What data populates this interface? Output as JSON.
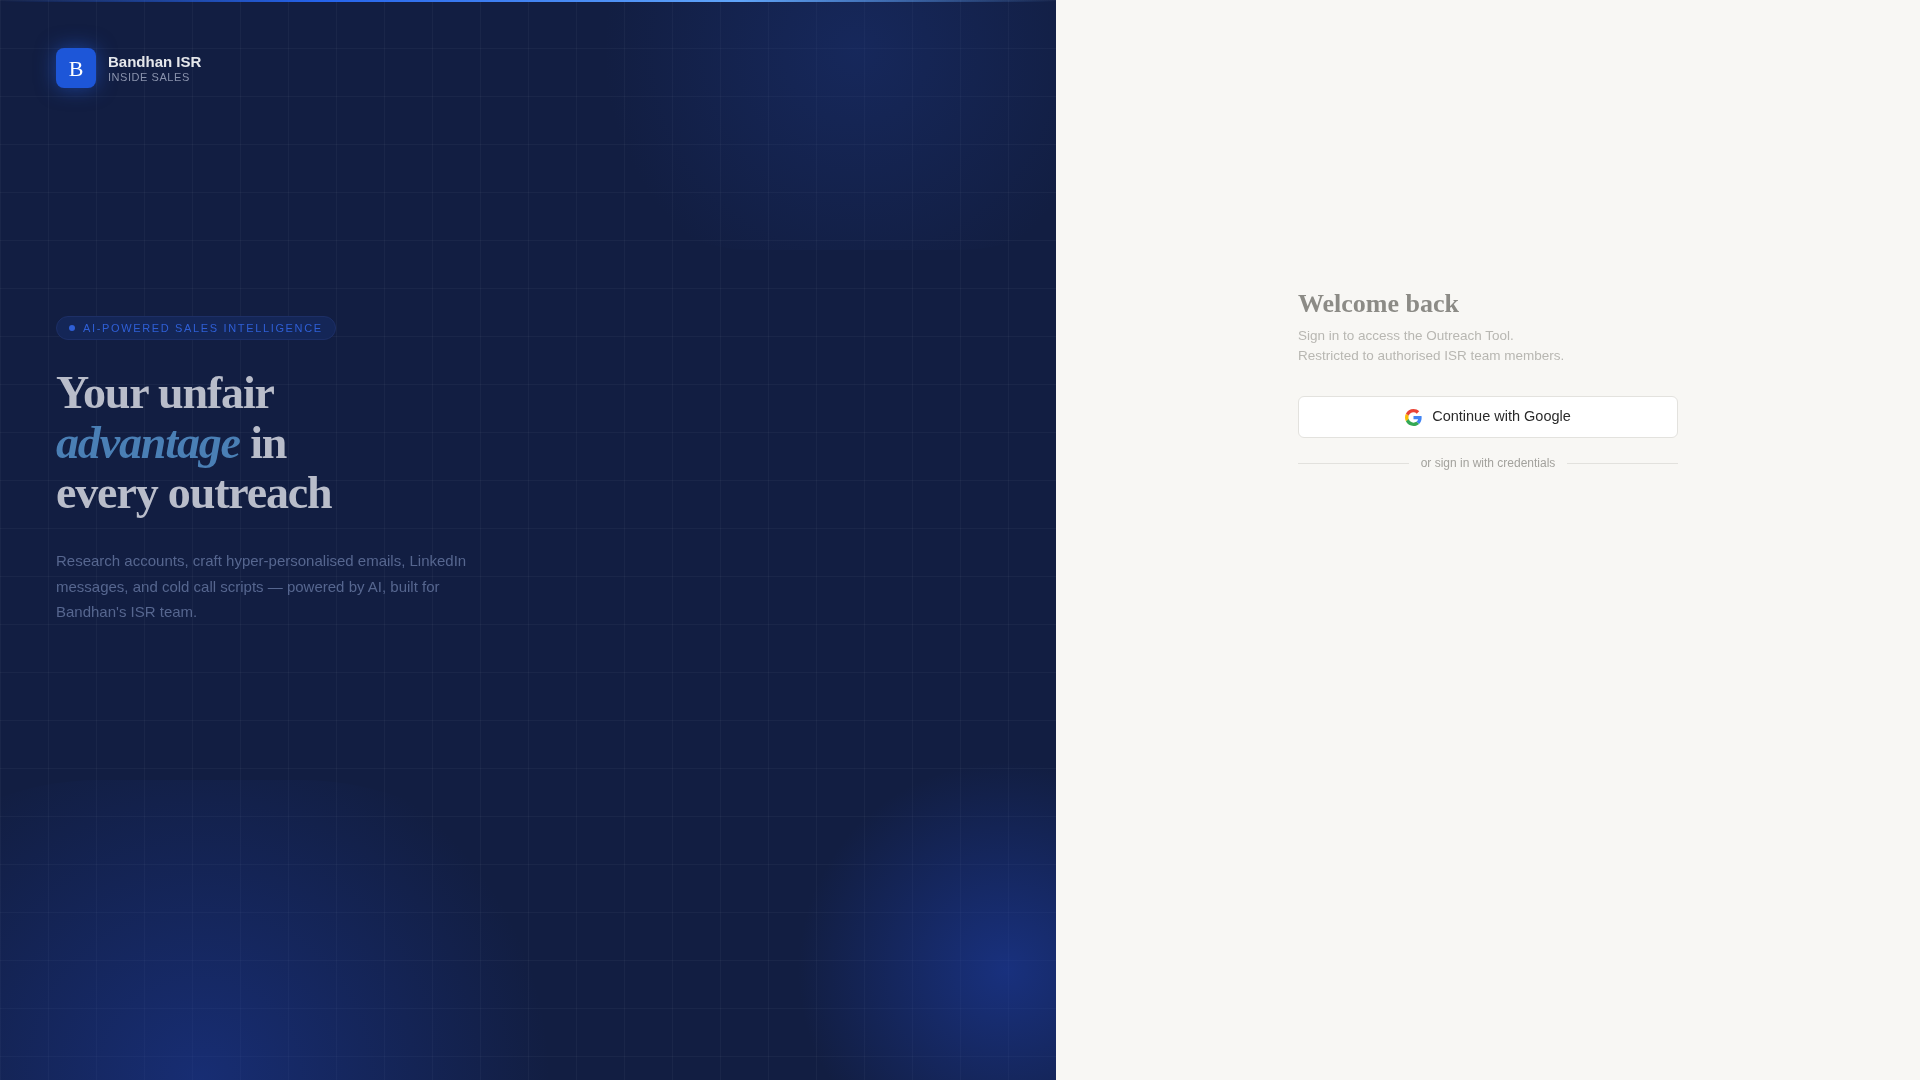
{
  "brand": {
    "logo_letter": "B",
    "name": "Bandhan ISR",
    "tagline": "INSIDE SALES"
  },
  "hero": {
    "badge": "AI-POWERED SALES INTELLIGENCE",
    "headline": "Your unfair *advantage* in every outreach",
    "description": "Research accounts, craft hyper-personalised emails, LinkedIn messages, and cold call scripts — powered by AI, built for Bandhan's ISR team."
  },
  "login": {
    "title": "Welcome back",
    "subtitle_lines": [
      "Sign in to access the Outreach Tool.",
      "Restricted to authorised ISR team members."
    ],
    "google_button": "Continue with Google",
    "divider": "or sign in with credentials"
  }
}
